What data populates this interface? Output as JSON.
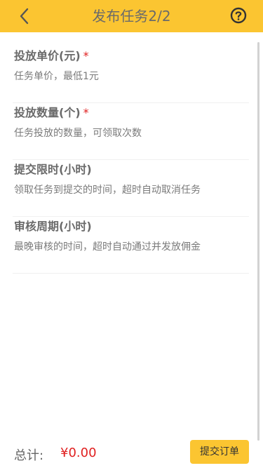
{
  "header": {
    "title": "发布任务2/2",
    "back_icon": "chevron-left-icon",
    "help_icon": "question-circle-icon",
    "background_color": "#fbc531"
  },
  "fields": [
    {
      "label": "投放单价(元)",
      "required_mark": "*",
      "placeholder": "任务单价，最低1元"
    },
    {
      "label": "投放数量(个)",
      "required_mark": "*",
      "placeholder": "任务投放的数量，可领取次数"
    },
    {
      "label": "提交限时(小时)",
      "required_mark": "",
      "placeholder": "领取任务到提交的时间，超时自动取消任务"
    },
    {
      "label": "审核周期(小时)",
      "required_mark": "",
      "placeholder": "最晚审核的时间，超时自动通过并发放佣金"
    }
  ],
  "footer": {
    "total_label": "总计:",
    "total_amount": "¥0.00",
    "submit_label": "提交订单"
  },
  "colors": {
    "accent": "#fbc531",
    "required": "#e02020",
    "amount": "#e02020"
  }
}
